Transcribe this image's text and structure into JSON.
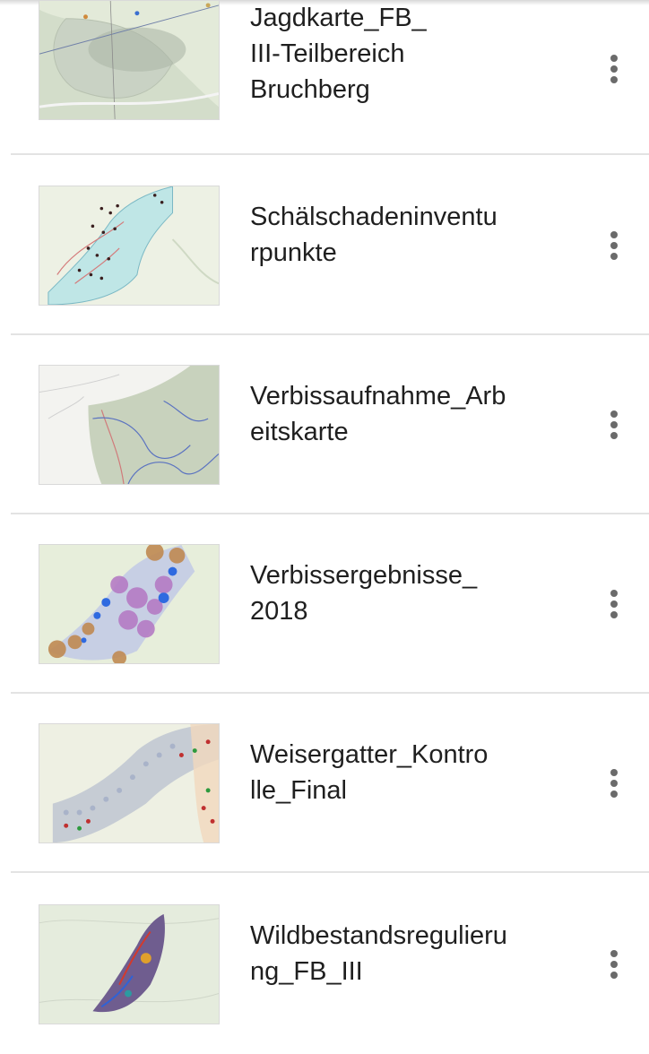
{
  "items": [
    {
      "title": "Jagdkarte_FB_\nIII-Teilbereich\nBruchberg",
      "thumb_icon": "map-thumbnail"
    },
    {
      "title": "Schälschadeninventu\nrpunkte",
      "thumb_icon": "map-thumbnail"
    },
    {
      "title": "Verbissaufnahme_Arb\neitskarte",
      "thumb_icon": "map-thumbnail"
    },
    {
      "title": "Verbissergebnisse_\n2018",
      "thumb_icon": "map-thumbnail"
    },
    {
      "title": "Weisergatter_Kontro\nlle_Final",
      "thumb_icon": "map-thumbnail"
    },
    {
      "title": "Wildbestandsregulieru\nng_FB_III",
      "thumb_icon": "map-thumbnail"
    }
  ],
  "menu_icon": "more-vertical-icon",
  "colors": {
    "divider": "#e3e3e3",
    "menu_dots": "#6b6b6b",
    "map_base": "#e9eedf"
  }
}
